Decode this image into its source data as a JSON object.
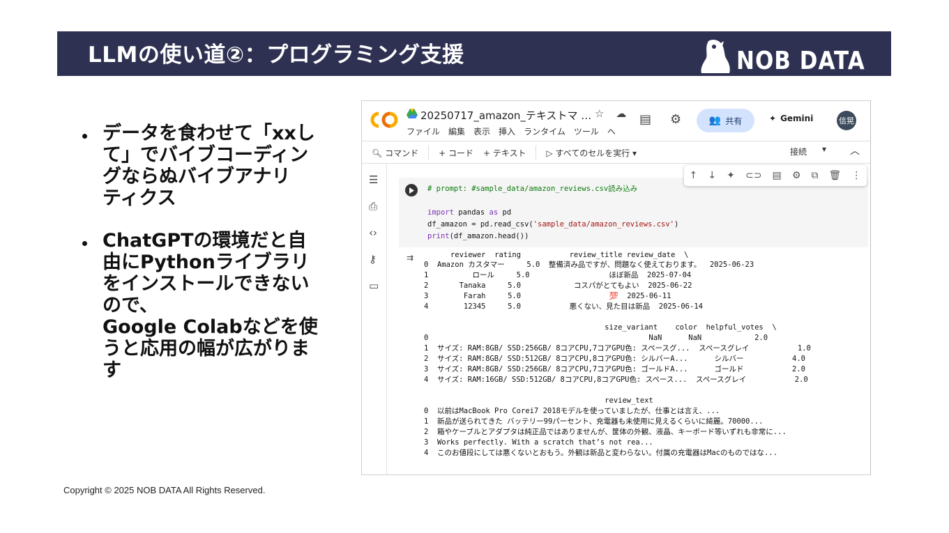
{
  "slide": {
    "title": "LLMの使い道②：プログラミング支援",
    "logo_text": "NOB DATA",
    "bullets": [
      "データを食わせて「xxし\nて」でバイブコーディン\nグならぬバイブアナリ\nティクス",
      "ChatGPTの環境だと自\n由にPythonライブラリ\nをインストールできない\nので、\nGoogle Colabなどを使\nうと応用の幅が広がりま\nす"
    ],
    "copyright": "Copyright © 2025 NOB DATA All Rights Reserved.",
    "colors": {
      "banner": "#2e3152",
      "text": "#111111"
    }
  },
  "colab": {
    "logo": "CO",
    "notebook_title": "20250717_amazon_テキストマ …",
    "title_icons": "☆ ☁",
    "menu": [
      "ファイル",
      "編集",
      "表示",
      "挿入",
      "ランタイム",
      "ツール",
      "へ"
    ],
    "share_label": "共有",
    "gemini_label": "Gemini",
    "avatar_text": "信晃",
    "toolbar": {
      "command": "コマンド",
      "add_code": "+ コード",
      "add_text": "+ テキスト",
      "run_all": "すべてのセルを実行",
      "connect": "接続"
    },
    "code_lines": [
      {
        "cls": "c-comment",
        "text": "# prompt: #sample_data/amazon_reviews.csv読み込み"
      },
      {
        "cls": "",
        "text": ""
      },
      {
        "cls": "",
        "parts": [
          [
            "c-kw",
            "import"
          ],
          [
            "",
            " pandas "
          ],
          [
            "c-kw",
            "as"
          ],
          [
            "",
            " pd"
          ]
        ]
      },
      {
        "cls": "",
        "parts": [
          [
            "",
            "df_amazon = pd.read_csv("
          ],
          [
            "c-str",
            "'sample_data/amazon_reviews.csv'"
          ],
          [
            "",
            ")"
          ]
        ]
      },
      {
        "cls": "",
        "parts": [
          [
            "c-kw",
            "print"
          ],
          [
            "",
            "(df_amazon.head())"
          ]
        ]
      }
    ],
    "output_lines": [
      "      reviewer  rating           review_title review_date  \\",
      "0  Amazon カスタマー     5.0  整備済み品ですが、問題なく使えております。  2025-06-23",
      "1          ロール     5.0                  ほぼ新品  2025-07-04",
      "2       Tanaka     5.0            コスパがとてもよい  2025-06-22",
      "3        Farah     5.0                    💯  2025-06-11",
      "4        12345     5.0           悪くない、見た目は新品  2025-06-14",
      "",
      "                                         size_variant    color  helpful_votes  \\",
      "0                                                  NaN      NaN            2.0",
      "1  サイズ: RAM:8GB/ SSD:256GB/ 8コアCPU,7コアGPU色: スペースグ...  スペースグレイ           1.0",
      "2  サイズ: RAM:8GB/ SSD:512GB/ 8コアCPU,8コアGPU色: シルバーA...      シルバー           4.0",
      "3  サイズ: RAM:8GB/ SSD:256GB/ 8コアCPU,7コアGPU色: ゴールドA...      ゴールド           2.0",
      "4  サイズ: RAM:16GB/ SSD:512GB/ 8コアCPU,8コアGPU色: スペース...  スペースグレイ           2.0",
      "",
      "                                         review_text",
      "0  以前はMacBook Pro Corei7 2018モデルを使っていましたが、仕事とは言え、...",
      "1  新品が送られてきた バッテリー99パーセント、充電器も未使用に見えるくらいに綺麗。70000...",
      "2  箱やケーブルとアダプタは純正品ではありませんが、筐体の外観、液晶、キーボード等いずれも非常に...",
      "3  Works perfectly. With a scratch that’s not rea...",
      "4  このお値段にしては悪くないとおもう。外観は新品と変わらない。付属の充電器はMacのものではな..."
    ]
  }
}
